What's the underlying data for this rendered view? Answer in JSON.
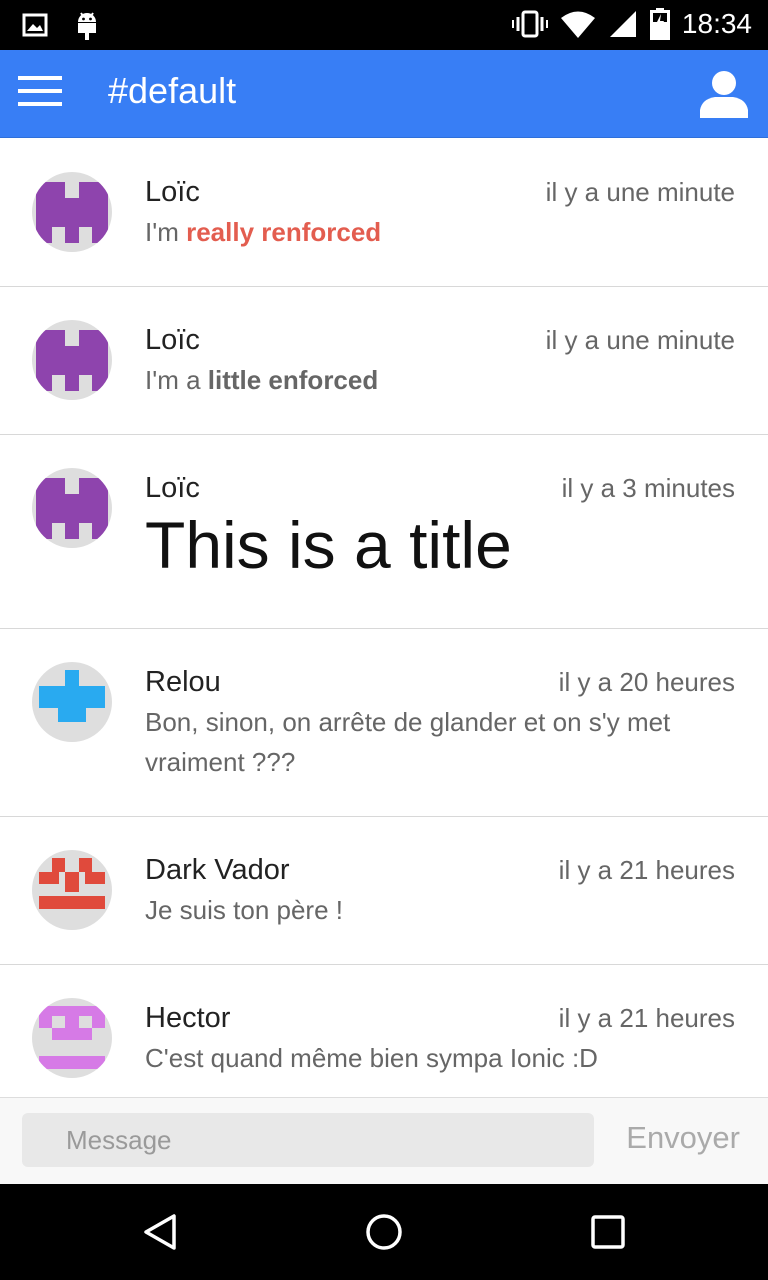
{
  "status_bar": {
    "time": "18:34",
    "left_icons": [
      "image-icon",
      "android-icon"
    ],
    "right_icons": [
      "vibrate-icon",
      "wifi-icon",
      "signal-icon",
      "battery-icon"
    ]
  },
  "header": {
    "title": "#default",
    "menu_icon": "hamburger-icon",
    "user_icon": "user-icon",
    "color": "#387ef5"
  },
  "messages": [
    {
      "author": "Loïc",
      "time": "il y a une minute",
      "text_prefix": "I'm ",
      "text_strong": "really renforced",
      "strong_color": "#e35d4f",
      "avatar_color": "#8e44ad"
    },
    {
      "author": "Loïc",
      "time": "il y a une minute",
      "text_prefix": "I'm a ",
      "text_strong": "little enforced",
      "avatar_color": "#8e44ad"
    },
    {
      "author": "Loïc",
      "time": "il y a 3 minutes",
      "title": "This is a title",
      "avatar_color": "#8e44ad"
    },
    {
      "author": "Relou",
      "time": "il y a 20 heures",
      "text": "Bon, sinon, on arrête de glander et on s'y met vraiment ???",
      "avatar_color": "#29aaf0"
    },
    {
      "author": "Dark Vador",
      "time": "il y a 21 heures",
      "text": "Je suis ton père !",
      "avatar_color": "#e04a3c"
    },
    {
      "author": "Hector",
      "time": "il y a 21 heures",
      "text": "C'est quand même bien sympa Ionic :D",
      "avatar_color": "#d67ae6"
    }
  ],
  "composer": {
    "placeholder": "Message",
    "value": "",
    "send_label": "Envoyer"
  },
  "nav_bar": {
    "buttons": [
      "back-icon",
      "home-icon",
      "recents-icon"
    ]
  }
}
